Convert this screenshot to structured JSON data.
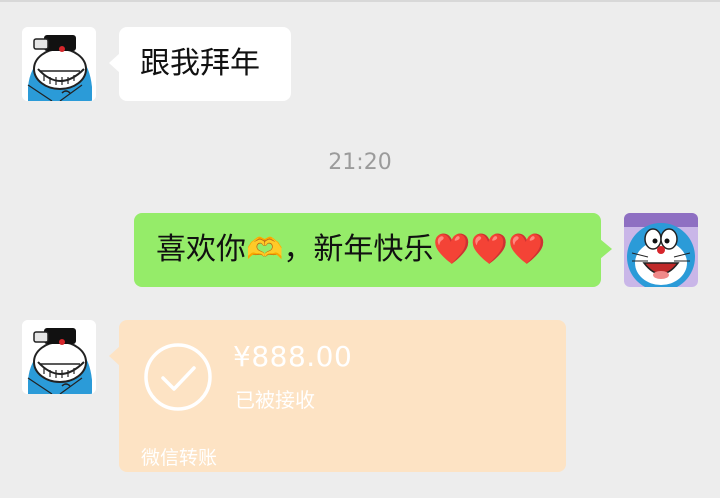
{
  "chat": {
    "messages": [
      {
        "sender": "contact",
        "text": "跟我拜年"
      },
      {
        "sender": "self",
        "text": "喜欢你🫶，新年快乐❤️❤️❤️"
      }
    ],
    "timestamp": "21:20",
    "transfer": {
      "amount": "¥888.00",
      "status": "已被接收",
      "label": "微信转账"
    }
  },
  "colors": {
    "background": "#ededed",
    "incoming_bubble": "#ffffff",
    "outgoing_bubble": "#95ec69",
    "transfer_card": "#fde3c4"
  },
  "icons": {
    "contact_avatar": "doraemon-grinning-avatar",
    "self_avatar": "doraemon-face-avatar",
    "transfer_check": "check-circle-icon"
  }
}
